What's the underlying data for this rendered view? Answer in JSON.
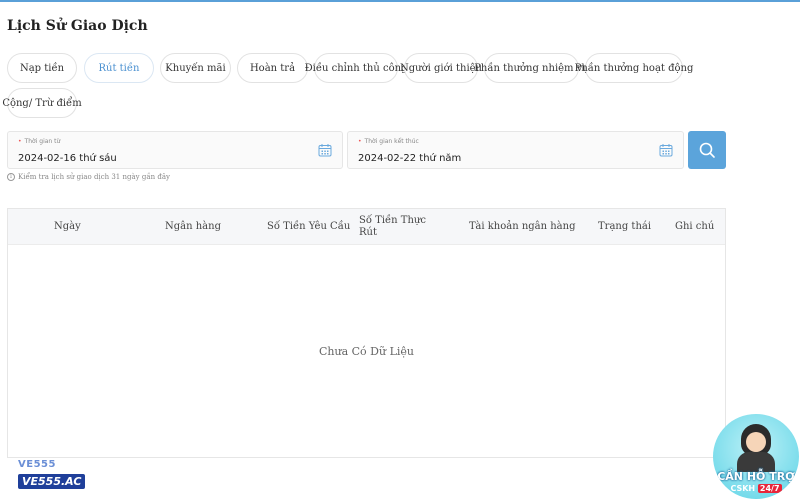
{
  "page": {
    "title": "Lịch Sử Giao Dịch"
  },
  "tabs": [
    {
      "label": "Nạp tiền",
      "active": false
    },
    {
      "label": "Rút tiền",
      "active": true
    },
    {
      "label": "Khuyến mãi",
      "active": false
    },
    {
      "label": "Hoàn trả",
      "active": false
    },
    {
      "label": "Điều chỉnh thủ công",
      "active": false
    },
    {
      "label": "Người giới thiệu",
      "active": false
    },
    {
      "label": "Phần thưởng nhiệm vụ",
      "active": false
    },
    {
      "label": "Phần thưởng hoạt động",
      "active": false
    },
    {
      "label": "Cộng/ Trừ điểm",
      "active": false
    }
  ],
  "filters": {
    "start": {
      "label": "Thời gian từ",
      "value": "2024-02-16 thứ sáu"
    },
    "end": {
      "label": "Thời gian kết thúc",
      "value": "2024-02-22 thứ năm"
    },
    "hint": "Kiểm tra lịch sử giao dịch 31 ngày gần đây"
  },
  "table": {
    "columns": [
      "Ngày",
      "Ngân hàng",
      "Số Tiền Yêu Cầu",
      "Số Tiền Thực Rút",
      "Tài khoản ngân hàng",
      "Trạng thái",
      "Ghi chú"
    ],
    "empty_text": "Chưa Có Dữ Liệu"
  },
  "brand": {
    "line1": "VE555",
    "line2": "VE555.AC"
  },
  "support": {
    "line1": "CẦN HỖ TRỢ",
    "line2": "CSKH",
    "line3": "24/7"
  },
  "colors": {
    "accent": "#5ba4db",
    "active_tab": "#4a90d0"
  },
  "icons": {
    "calendar": "calendar-icon",
    "search": "search-icon",
    "info": "info-icon"
  }
}
